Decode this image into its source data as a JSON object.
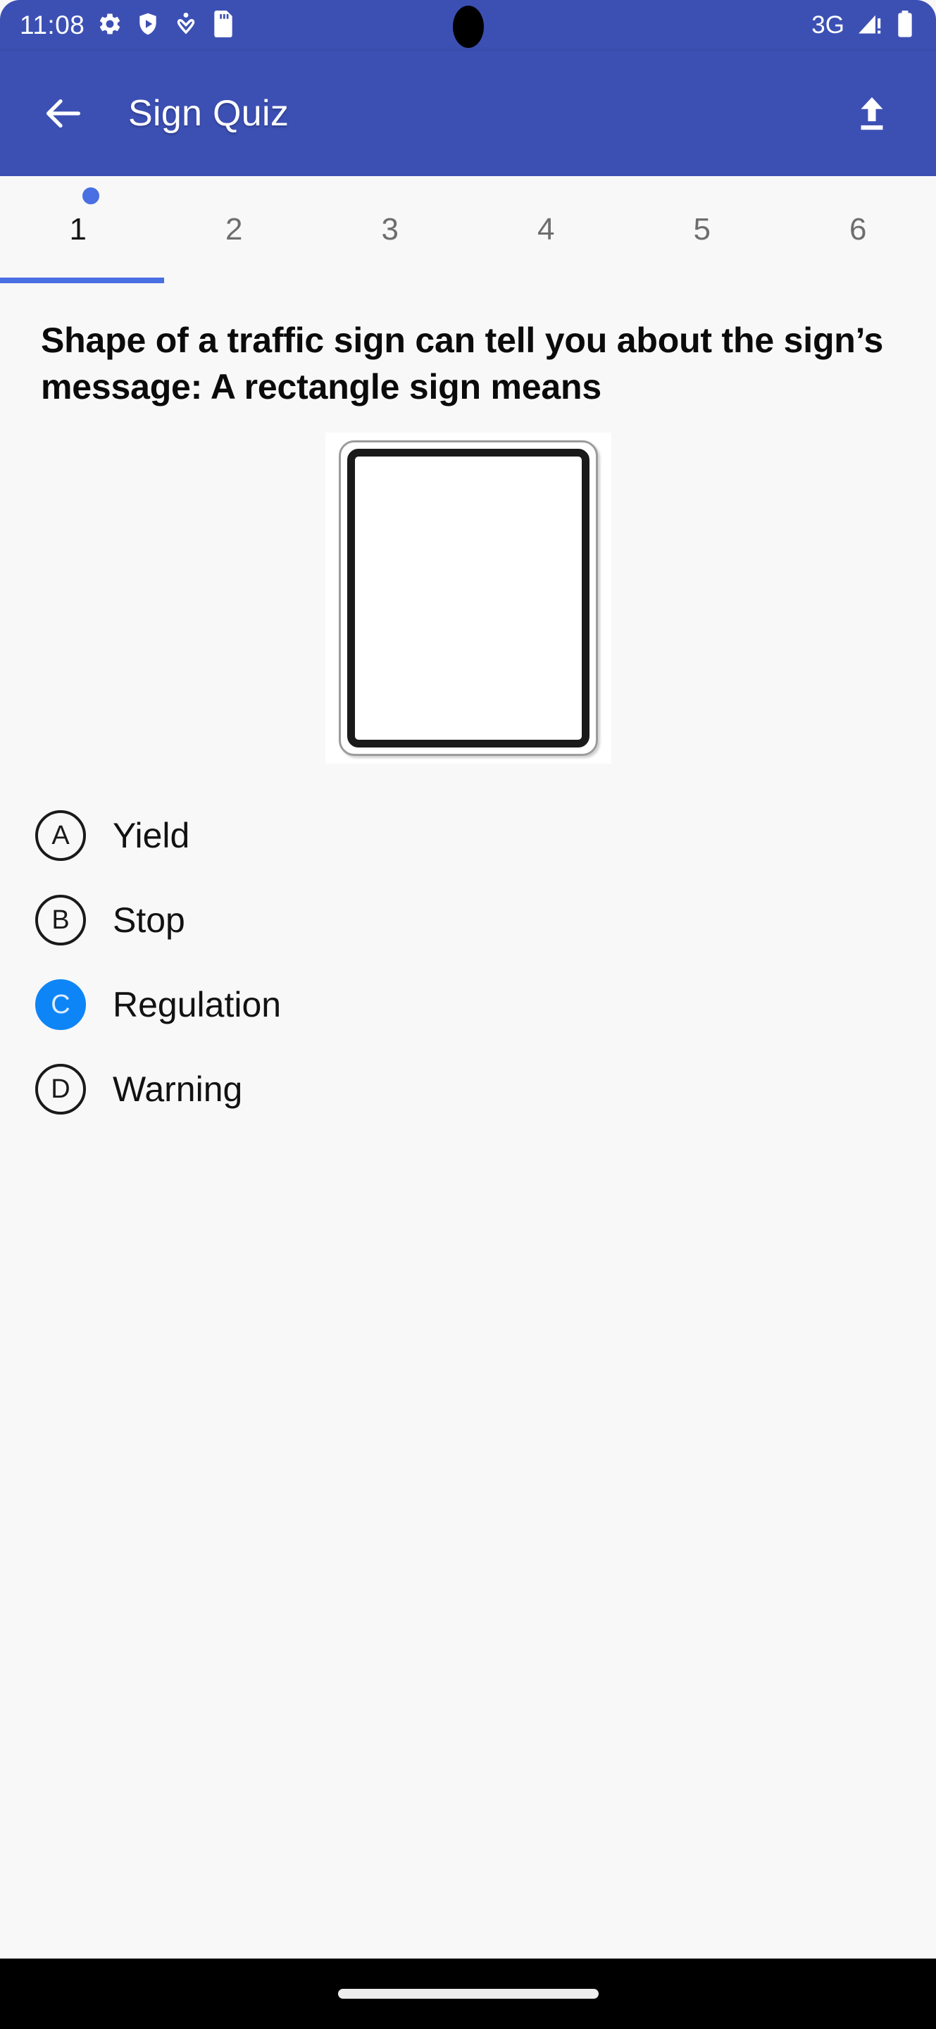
{
  "status_bar": {
    "time": "11:08",
    "network_type": "3G",
    "left_icons": [
      "settings-gear-icon",
      "play-protect-shield-icon",
      "accessibility-person-icon",
      "sd-card-icon"
    ],
    "right_icons": [
      "signal-warning-icon",
      "battery-full-icon"
    ],
    "background_color": "#3C50B4"
  },
  "app_bar": {
    "title": "Sign Quiz",
    "back_icon": "back-arrow-icon",
    "action_icon": "upload-icon",
    "background_color": "#3C50B4"
  },
  "tabs": {
    "items": [
      {
        "label": "1",
        "active": true
      },
      {
        "label": "2",
        "active": false
      },
      {
        "label": "3",
        "active": false
      },
      {
        "label": "4",
        "active": false
      },
      {
        "label": "5",
        "active": false
      },
      {
        "label": "6",
        "active": false
      }
    ],
    "active_index": 0,
    "indicator_color": "#4A6FE3",
    "dot_color": "#4A6FE3"
  },
  "question": {
    "text": "Shape of a traffic sign can tell you about the sign’s message: A rectangle sign means",
    "image": {
      "name": "rectangle-traffic-sign-image",
      "description": "blank white vertical rectangle sign with thick black border"
    }
  },
  "options": [
    {
      "letter": "A",
      "label": "Yield",
      "selected": false
    },
    {
      "letter": "B",
      "label": "Stop",
      "selected": false
    },
    {
      "letter": "C",
      "label": "Regulation",
      "selected": true
    },
    {
      "letter": "D",
      "label": "Warning",
      "selected": false
    }
  ],
  "theme": {
    "page_background": "#F8F8F8",
    "selected_badge_color": "#0E85F7",
    "text_color": "#121212",
    "inactive_tab_color": "#6E6E6E"
  },
  "nav_bar": {
    "handle": "gesture-home-handle",
    "background_color": "#000000"
  }
}
